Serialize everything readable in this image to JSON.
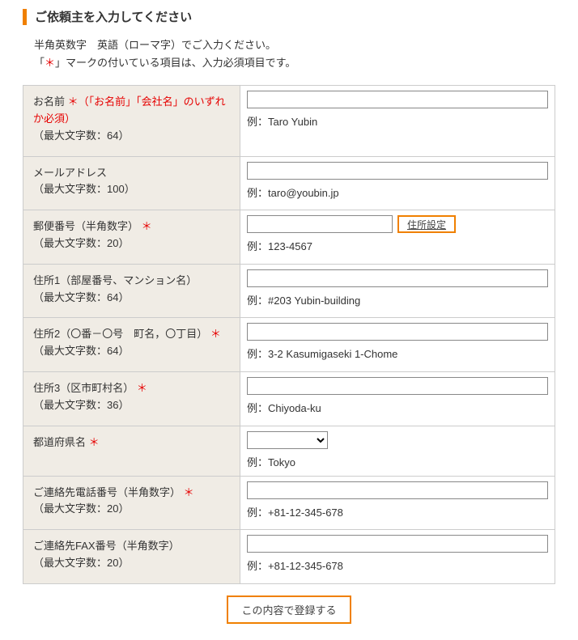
{
  "title": "ご依頼主を入力してください",
  "intro_line1": "半角英数字　英語（ローマ字）でご入力ください。",
  "intro_prefix": "「",
  "intro_asterisk": "＊",
  "intro_suffix": "」マークの付いている項目は、入力必須項目です。",
  "fields": {
    "name": {
      "label_prefix": "お名前 ",
      "required_mark": "＊",
      "label_note": "（「お名前」「会社名」のいずれか必須）",
      "sub": "（最大文字数：64）",
      "example": "例：Taro Yubin"
    },
    "email": {
      "label": "メールアドレス",
      "sub": "（最大文字数：100）",
      "example": "例：taro@youbin.jp"
    },
    "postal": {
      "label": "郵便番号（半角数字） ",
      "required_mark": "＊",
      "sub": "（最大文字数：20）",
      "btn": "住所設定",
      "example": "例：123-4567"
    },
    "addr1": {
      "label": "住所1（部屋番号、マンション名）",
      "sub": "（最大文字数：64）",
      "example": "例：#203 Yubin-building"
    },
    "addr2": {
      "label": "住所2（〇番－〇号　町名，〇丁目） ",
      "required_mark": "＊",
      "sub": "（最大文字数：64）",
      "example": "例：3-2 Kasumigaseki 1-Chome"
    },
    "addr3": {
      "label": "住所3（区市町村名） ",
      "required_mark": "＊",
      "sub": "（最大文字数：36）",
      "example": "例：Chiyoda-ku"
    },
    "pref": {
      "label": "都道府県名 ",
      "required_mark": "＊",
      "example": "例：Tokyo"
    },
    "phone": {
      "label": "ご連絡先電話番号（半角数字） ",
      "required_mark": "＊",
      "sub": "（最大文字数：20）",
      "example": "例：+81-12-345-678"
    },
    "fax": {
      "label": "ご連絡先FAX番号（半角数字）",
      "sub": "（最大文字数：20）",
      "example": "例：+81-12-345-678"
    }
  },
  "submit": "この内容で登録する"
}
